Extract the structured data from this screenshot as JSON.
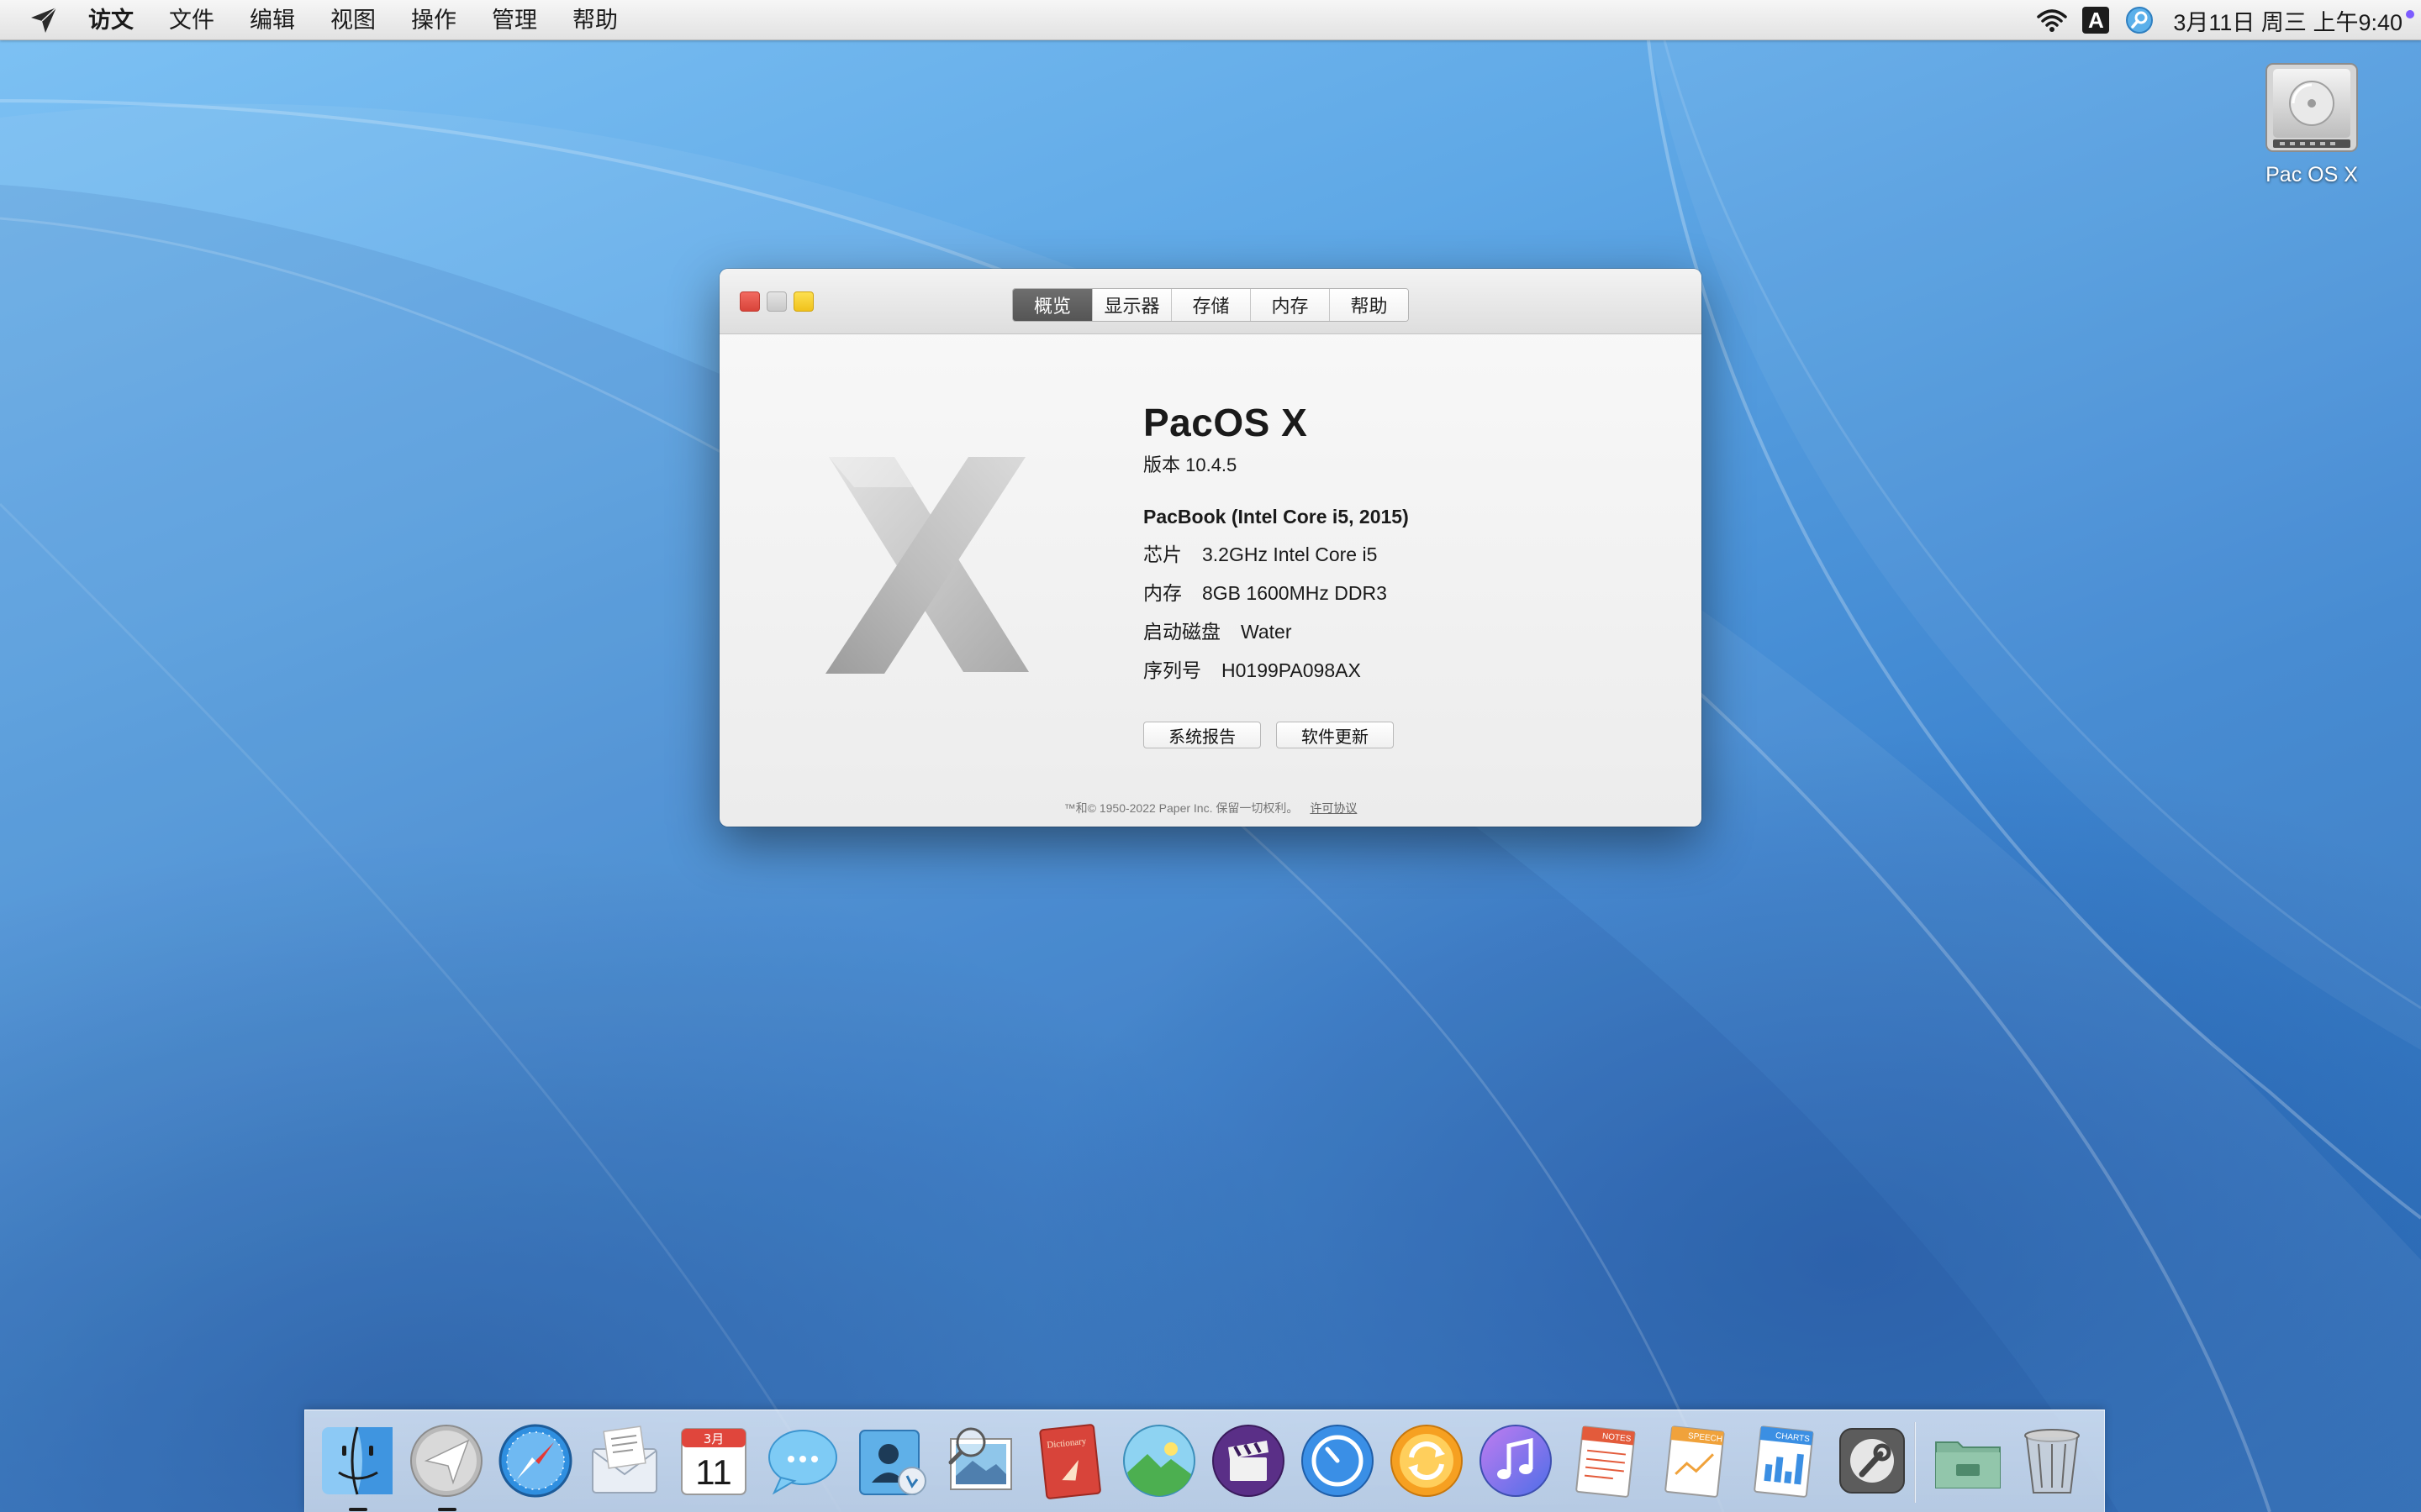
{
  "menubar": {
    "apple_icon": "paper-plane-icon",
    "app_name": "访文",
    "items": [
      "文件",
      "编辑",
      "视图",
      "操作",
      "管理",
      "帮助"
    ],
    "status_icons": [
      "wifi-icon",
      "input-source-icon",
      "spotlight-icon"
    ],
    "input_source_letter": "A",
    "clock": "3月11日 周三 上午9:40"
  },
  "desktop": {
    "icons": [
      {
        "label": "Pac OS X",
        "icon": "hard-drive-icon"
      }
    ]
  },
  "about_window": {
    "tabs": [
      {
        "label": "概览",
        "active": true
      },
      {
        "label": "显示器",
        "active": false
      },
      {
        "label": "存储",
        "active": false
      },
      {
        "label": "内存",
        "active": false
      },
      {
        "label": "帮助",
        "active": false
      }
    ],
    "os_name": "PacOS X",
    "version": "版本 10.4.5",
    "model": "PacBook (Intel Core i5, 2015)",
    "specs": [
      {
        "key": "芯片",
        "value": "3.2GHz Intel Core i5"
      },
      {
        "key": "内存",
        "value": "8GB 1600MHz DDR3"
      },
      {
        "key": "启动磁盘",
        "value": "Water"
      },
      {
        "key": "序列号",
        "value": "H0199PA098AX"
      }
    ],
    "buttons": [
      "系统报告",
      "软件更新"
    ],
    "footer_text": "™和© 1950-2022 Paper Inc. 保留一切权利。",
    "footer_link": "许可协议"
  },
  "dock": {
    "items": [
      {
        "name": "finder",
        "running": true
      },
      {
        "name": "launchpad",
        "running": true
      },
      {
        "name": "safari",
        "running": false
      },
      {
        "name": "mail",
        "running": false
      },
      {
        "name": "calendar",
        "running": false,
        "month": "3月",
        "day": "11"
      },
      {
        "name": "messages",
        "running": false
      },
      {
        "name": "contacts",
        "running": false
      },
      {
        "name": "preview",
        "running": false
      },
      {
        "name": "dictionary",
        "running": false,
        "label": "Dictionary"
      },
      {
        "name": "photos",
        "running": false
      },
      {
        "name": "movie",
        "running": false
      },
      {
        "name": "clock",
        "running": false
      },
      {
        "name": "sync",
        "running": false
      },
      {
        "name": "music",
        "running": false
      },
      {
        "name": "notes",
        "running": false,
        "label": "NOTES"
      },
      {
        "name": "speech",
        "running": false,
        "label": "SPEECH"
      },
      {
        "name": "charts",
        "running": false,
        "label": "CHARTS"
      },
      {
        "name": "system-utility",
        "running": false
      },
      {
        "name": "folder",
        "running": false
      },
      {
        "name": "trash",
        "running": false
      }
    ]
  },
  "colors": {
    "close": "#f26a60",
    "minimize": "#d6d6d6",
    "zoom": "#fde050",
    "active_tab": "#5f5f5f"
  }
}
